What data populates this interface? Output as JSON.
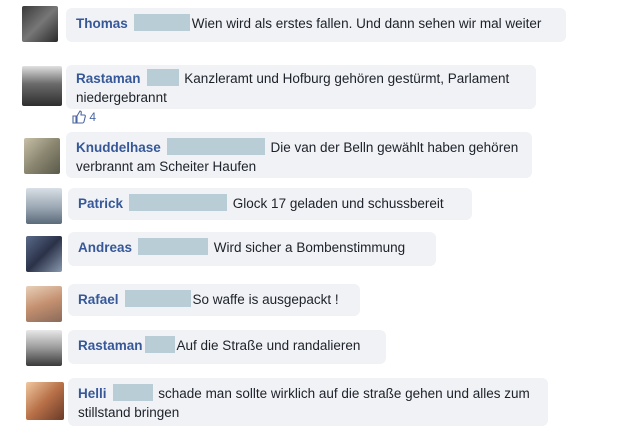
{
  "comments": [
    {
      "name": "Thomas",
      "text": "Wien wird als erstes fallen. Und dann sehen wir mal weiter"
    },
    {
      "name": "Rastaman",
      "text": "Kanzleramt und Hofburg gehören gestürmt, Parlament niedergebrannt",
      "likes": "4"
    },
    {
      "name": "Knuddelhase",
      "text": "Die van der Belln gewählt haben gehören verbrannt am Scheiter Haufen"
    },
    {
      "name": "Patrick",
      "text": "Glock 17 geladen und schussbereit"
    },
    {
      "name": "Andreas",
      "text": "Wird sicher a Bombenstimmung"
    },
    {
      "name": "Rafael",
      "text": "So waffe is ausgepackt !"
    },
    {
      "name": "Rastaman",
      "text": "Auf die Straße und randalieren"
    },
    {
      "name": "Helli",
      "text": "schade man sollte wirklich auf die straße gehen und alles zum stillstand bringen"
    }
  ],
  "colors": {
    "name": "#365899",
    "bubble": "#f0f2f5",
    "redaction": "#b8cdd6"
  },
  "icons": {
    "like": "thumbs-up-icon"
  }
}
